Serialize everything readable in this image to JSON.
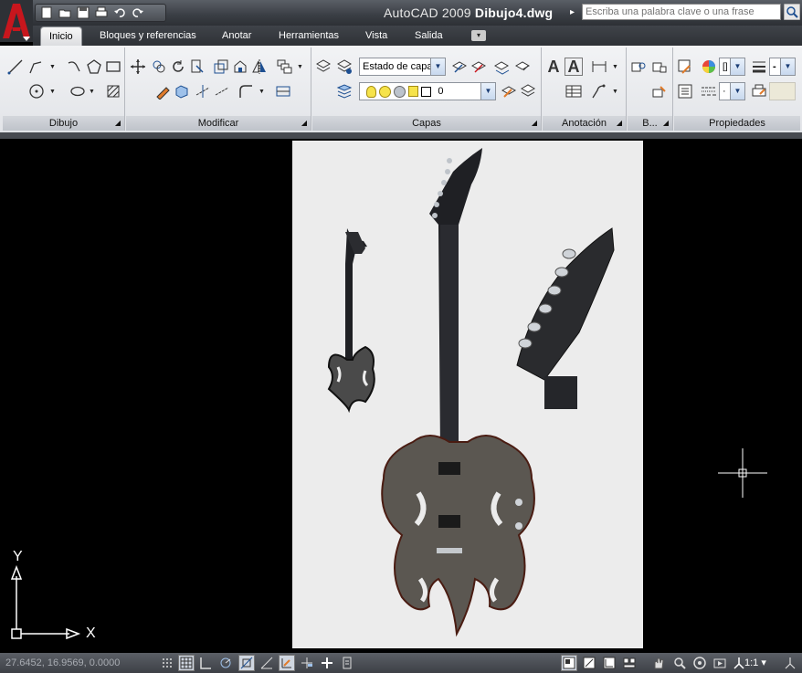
{
  "window": {
    "app_name": "AutoCAD 2009",
    "file_name": "Dibujo4.dwg"
  },
  "search": {
    "placeholder": "Escriba una palabra clave o una frase"
  },
  "quick_access": [
    "new-icon",
    "open-icon",
    "save-icon",
    "print-icon",
    "undo-icon",
    "redo-icon"
  ],
  "tabs": [
    {
      "label": "Inicio",
      "active": true
    },
    {
      "label": "Bloques y referencias"
    },
    {
      "label": "Anotar"
    },
    {
      "label": "Herramientas"
    },
    {
      "label": "Vista"
    },
    {
      "label": "Salida"
    }
  ],
  "panels": {
    "dibujo": "Dibujo",
    "modificar": "Modificar",
    "capas": "Capas",
    "anotacion": "Anotación",
    "bloques": "B...",
    "propiedades": "Propiedades"
  },
  "capas": {
    "layer_state": "Estado de capa",
    "current_layer": "0"
  },
  "propiedades": {
    "color_value": "[]",
    "linetype_value": "·",
    "lineweight_value": "-"
  },
  "ucs": {
    "y_label": "Y",
    "x_label": "X"
  },
  "status": {
    "coordinates": "27.6452, 16.9569, 0.0000",
    "scale": "1:1"
  },
  "colors": {
    "canvas": "#000000",
    "ribbon": "#e6e8eb",
    "titlebar": "#3a3e44",
    "logo_red": "#c8161d",
    "sheet": "#ececec"
  }
}
